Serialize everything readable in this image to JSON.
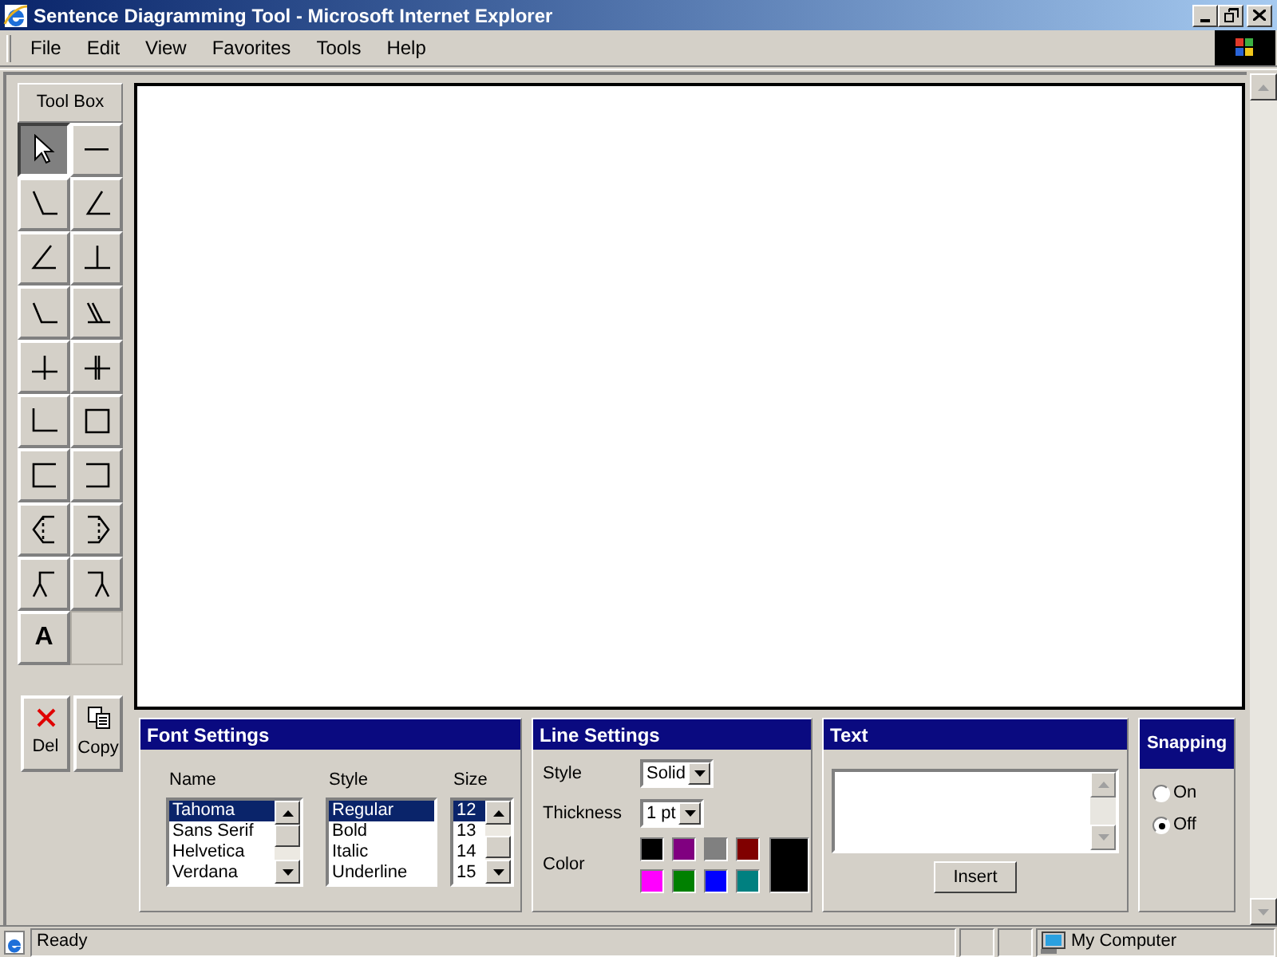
{
  "window": {
    "title": "Sentence Diagramming Tool - Microsoft Internet Explorer"
  },
  "menu": [
    "File",
    "Edit",
    "View",
    "Favorites",
    "Tools",
    "Help"
  ],
  "toolbox": {
    "title": "Tool Box",
    "tools": [
      {
        "kind": "pointer",
        "selected": true
      },
      {
        "kind": "dash",
        "selected": false
      },
      {
        "kind": "diag-left",
        "selected": false
      },
      {
        "kind": "diag-right",
        "selected": false
      },
      {
        "kind": "angle",
        "selected": false
      },
      {
        "kind": "tee",
        "selected": false
      },
      {
        "kind": "slant",
        "selected": false
      },
      {
        "kind": "double-slant",
        "selected": false
      },
      {
        "kind": "cross",
        "selected": false
      },
      {
        "kind": "double-cross",
        "selected": false
      },
      {
        "kind": "corner",
        "selected": false
      },
      {
        "kind": "square",
        "selected": false
      },
      {
        "kind": "bracket-left",
        "selected": false
      },
      {
        "kind": "bracket-right",
        "selected": false
      },
      {
        "kind": "arrow-left",
        "selected": false
      },
      {
        "kind": "arrow-right",
        "selected": false
      },
      {
        "kind": "fork-left",
        "selected": false
      },
      {
        "kind": "fork-right",
        "selected": false
      },
      {
        "kind": "text",
        "label": "A",
        "selected": false
      }
    ],
    "actions": [
      {
        "kind": "delete",
        "label": "Del"
      },
      {
        "kind": "copy",
        "label": "Copy"
      }
    ]
  },
  "font_settings": {
    "title": "Font Settings",
    "name": {
      "label": "Name",
      "items": [
        {
          "text": "Tahoma",
          "selected": true
        },
        {
          "text": "Sans Serif",
          "selected": false
        },
        {
          "text": "Helvetica",
          "selected": false
        },
        {
          "text": "Verdana",
          "selected": false
        }
      ]
    },
    "style": {
      "label": "Style",
      "items": [
        {
          "text": "Regular",
          "selected": true
        },
        {
          "text": "Bold",
          "selected": false
        },
        {
          "text": "Italic",
          "selected": false
        },
        {
          "text": "Underline",
          "selected": false
        }
      ]
    },
    "size": {
      "label": "Size",
      "items": [
        {
          "text": "12",
          "selected": true
        },
        {
          "text": "13",
          "selected": false
        },
        {
          "text": "14",
          "selected": false
        },
        {
          "text": "15",
          "selected": false
        }
      ]
    }
  },
  "line_settings": {
    "title": "Line Settings",
    "style": {
      "label": "Style",
      "value": "Solid"
    },
    "thickness": {
      "label": "Thickness",
      "value": "1 pt"
    },
    "color": {
      "label": "Color",
      "swatches": [
        {
          "color": "#000000"
        },
        {
          "color": "#800080"
        },
        {
          "color": "#808080"
        },
        {
          "color": "#800000"
        },
        {
          "color": "#ff00ff"
        },
        {
          "color": "#008000"
        },
        {
          "color": "#0000ff"
        },
        {
          "color": "#008080"
        }
      ],
      "current": {
        "color": "#000000"
      }
    }
  },
  "text_panel": {
    "title": "Text",
    "button": "Insert"
  },
  "snapping": {
    "title": "Snapping",
    "options": [
      {
        "label": "On",
        "selected": false
      },
      {
        "label": "Off",
        "selected": true
      }
    ]
  },
  "status_bar": {
    "text": "Ready",
    "zone": "My Computer"
  }
}
